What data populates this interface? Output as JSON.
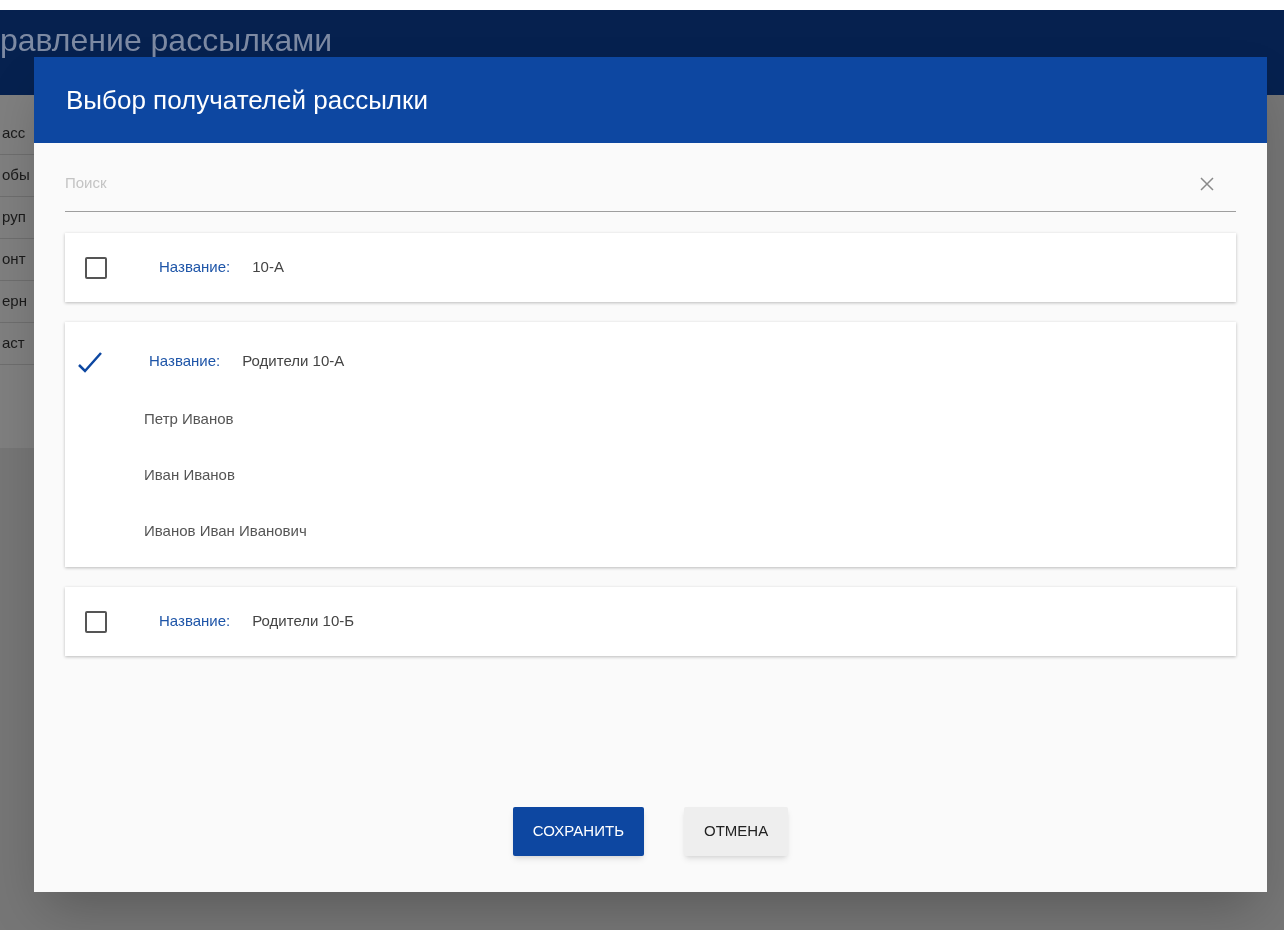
{
  "page": {
    "title": "равление рассылками",
    "sidebar": {
      "items": [
        {
          "label": "асс"
        },
        {
          "label": "обы"
        },
        {
          "label": "руп"
        },
        {
          "label": "онт"
        },
        {
          "label": "ерн"
        },
        {
          "label": "аст"
        }
      ]
    }
  },
  "dialog": {
    "title": "Выбор получателей рассылки",
    "search": {
      "placeholder": "Поиск"
    },
    "groups": [
      {
        "label": "Название:",
        "name": "10-А",
        "checked": false
      },
      {
        "label": "Название:",
        "name": "Родители 10-А",
        "checked": true,
        "members": [
          "Петр Иванов",
          "Иван Иванов",
          "Иванов Иван Иванович"
        ]
      },
      {
        "label": "Название:",
        "name": "Родители 10-Б",
        "checked": false
      }
    ],
    "buttons": [
      {
        "label": "СОХРАНИТЬ",
        "kind": "primary"
      },
      {
        "label": "ОТМЕНА",
        "kind": "secondary"
      }
    ]
  }
}
